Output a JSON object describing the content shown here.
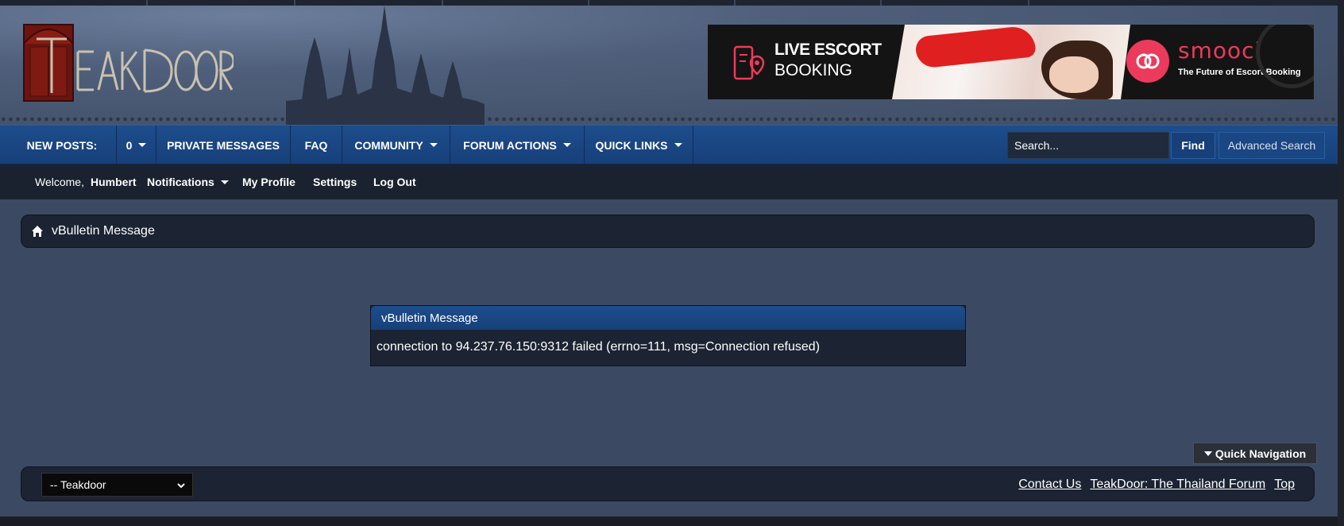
{
  "header": {
    "logo_text": "TEAKDOOR",
    "banner": {
      "title_line1": "LIVE ESCORT",
      "title_line2": "BOOKING",
      "brand": "smooci",
      "tagline": "The Future of Escort Booking"
    }
  },
  "nav": {
    "items": [
      {
        "label": "NEW POSTS:"
      },
      {
        "label": "0"
      },
      {
        "label": "PRIVATE MESSAGES"
      },
      {
        "label": "FAQ"
      },
      {
        "label": "COMMUNITY"
      },
      {
        "label": "FORUM ACTIONS"
      },
      {
        "label": "QUICK LINKS"
      }
    ],
    "search_placeholder": "Search...",
    "find_label": "Find",
    "advanced_search_label": "Advanced Search"
  },
  "subnav": {
    "welcome": "Welcome,",
    "username": "Humbert",
    "notifications": "Notifications",
    "my_profile": "My Profile",
    "settings": "Settings",
    "log_out": "Log Out"
  },
  "breadcrumb": {
    "title": "vBulletin Message"
  },
  "message": {
    "title": "vBulletin Message",
    "body": "connection to 94.237.76.150:9312 failed (errno=111, msg=Connection refused)"
  },
  "quick_nav": {
    "label": "Quick Navigation"
  },
  "footer": {
    "select_value": "-- Teakdoor",
    "links": [
      "Contact Us",
      "TeakDoor: The Thailand Forum",
      "Top"
    ]
  },
  "colors": {
    "nav_blue": "#1d4d8c",
    "page_bg": "#3b4a62",
    "panel_bg": "#1c2433",
    "accent_pink": "#ec3a5c"
  }
}
